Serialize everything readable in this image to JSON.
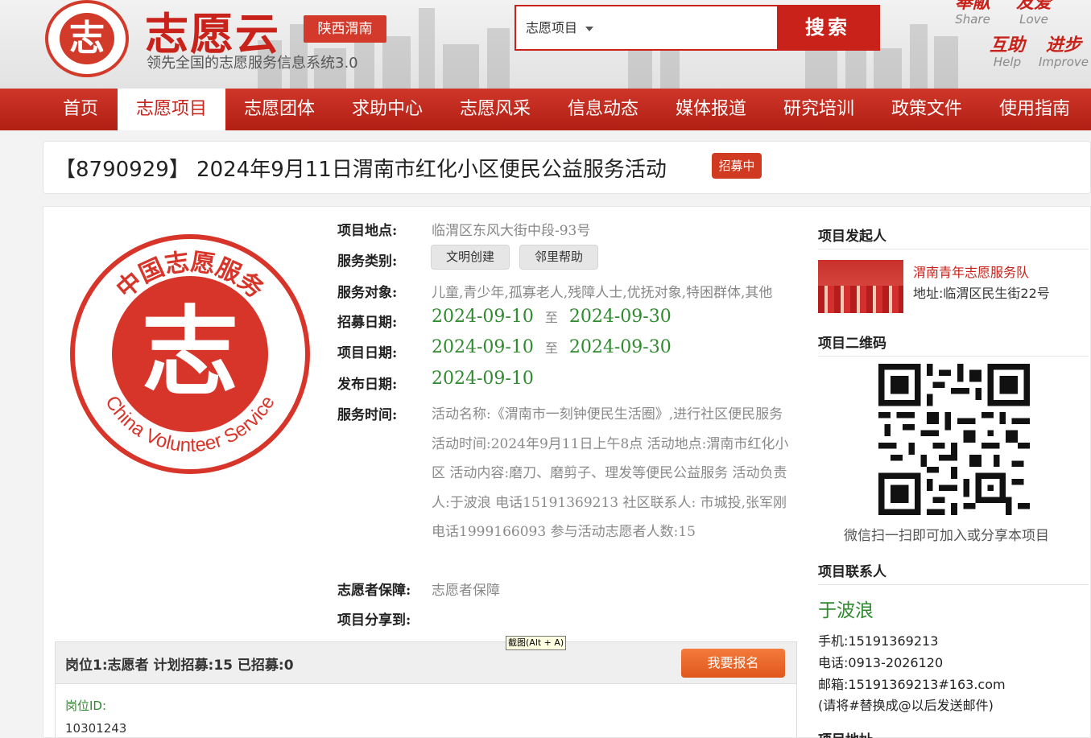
{
  "header": {
    "logo_char": "志",
    "brand": "志愿云",
    "region": "陕西渭南",
    "slogan": "领先全国的志愿服务信息系统3.0",
    "search": {
      "select_value": "志愿项目",
      "placeholder": "",
      "button": "搜索"
    },
    "mottos": [
      {
        "cn": "奉献",
        "en": "Share"
      },
      {
        "cn": "友爱",
        "en": "Love"
      },
      {
        "cn": "互助",
        "en": "Help"
      },
      {
        "cn": "进步",
        "en": "Improve"
      }
    ]
  },
  "nav": {
    "items": [
      "首页",
      "志愿项目",
      "志愿团体",
      "求助中心",
      "志愿风采",
      "信息动态",
      "媒体报道",
      "研究培训",
      "政策文件",
      "使用指南"
    ],
    "active_index": 1
  },
  "project": {
    "title": "【8790929】 2024年9月11日渭南市红化小区便民公益服务活动",
    "status_badge": "招募中",
    "labels": {
      "location": "项目地点:",
      "category": "服务类别:",
      "target": "服务对象:",
      "recruit_date": "招募日期:",
      "project_date": "项目日期:",
      "publish_date": "发布日期:",
      "service_time": "服务时间:",
      "guarantee": "志愿者保障:",
      "share": "项目分享到:"
    },
    "location": "临渭区东风大街中段-93号",
    "categories": [
      "文明创建",
      "邻里帮助"
    ],
    "target": "儿童,青少年,孤寡老人,残障人士,优抚对象,特困群体,其他",
    "recruit_start": "2024-09-10",
    "recruit_end": "2024-09-30",
    "project_start": "2024-09-10",
    "project_end": "2024-09-30",
    "date_sep": "至",
    "publish_date": "2024-09-10",
    "service_desc": "活动名称:《渭南市一刻钟便民生活圈》,进行社区便民服务 活动时间:2024年9月11日上午8点 活动地点:渭南市红化小区 活动内容:磨刀、磨剪子、理发等便民公益服务 活动负责人:于波浪 电话15191369213 社区联系人: 市城投,张军刚 电话1999166093 参与活动志愿者人数:15",
    "guarantee": "志愿者保障",
    "logo_ring_cn": "中国志愿服务",
    "logo_ring_en": "China Volunteer Service"
  },
  "position": {
    "summary": "岗位1:志愿者   计划招募:15   已招募:0",
    "signup_button": "我要报名",
    "id_label": "岗位ID:",
    "id_value": "10301243",
    "tooltip": "截图(Alt + A)"
  },
  "sidebar": {
    "initiator_heading": "项目发起人",
    "org_name": "渭南青年志愿服务队",
    "org_address": "地址:临渭区民生街22号",
    "qr_heading": "项目二维码",
    "qr_caption": "微信扫一扫即可加入或分享本项目",
    "contact_heading": "项目联系人",
    "contact_name": "于波浪",
    "mobile": "手机:15191369213",
    "phone": "电话:0913-2026120",
    "email": "邮箱:15191369213#163.com",
    "email_note": "(请将#替换成@以后发送邮件)",
    "address_heading": "项目地址"
  },
  "colors": {
    "brand_red": "#c8221a",
    "date_green": "#2e8b2e",
    "signup_orange": "#e8642a"
  }
}
